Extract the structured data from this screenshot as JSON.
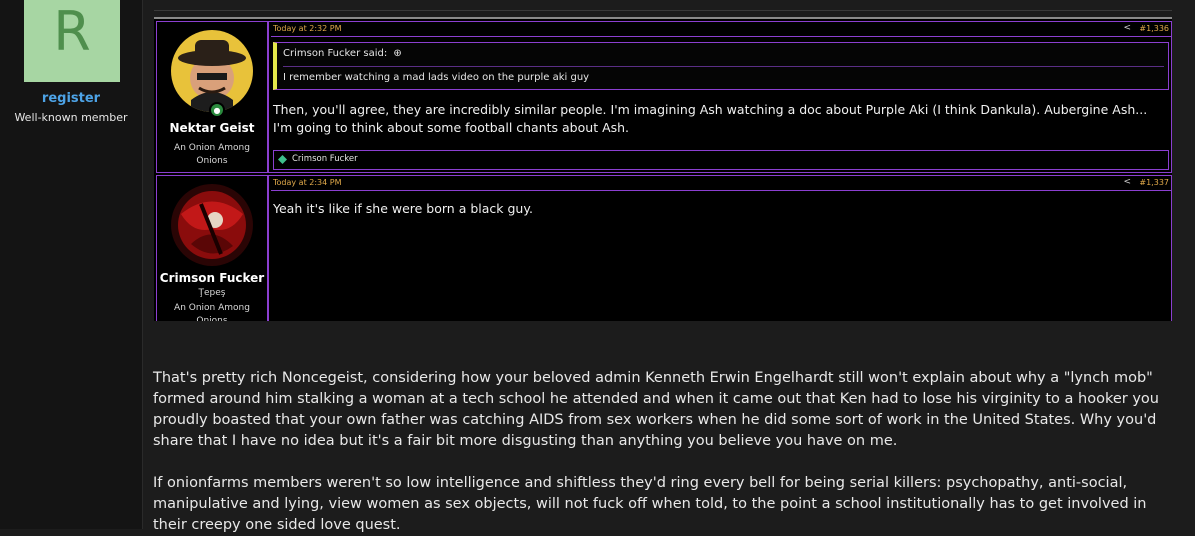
{
  "sidebar": {
    "avatar_letter": "R",
    "username": "register",
    "user_title": "Well-known member"
  },
  "embed": {
    "posts": [
      {
        "username": "Nektar Geist",
        "user_title": "An Onion Among Onions",
        "time": "Today at 2:32 PM",
        "post_number": "#1,336",
        "quote": {
          "author": "Crimson Fucker said:",
          "text": "I remember watching a mad lads video on the purple aki guy"
        },
        "text": "Then, you'll agree, they are incredibly similar people. I'm imagining Ash watching a doc about Purple Aki (I think Dankula). Aubergine Ash... I'm going to think about some football chants about Ash.",
        "reaction_user": "Crimson Fucker"
      },
      {
        "username": "Crimson Fucker",
        "user_subtitle": "Ţepeş",
        "user_title": "An Onion Among Onions",
        "time": "Today at 2:34 PM",
        "post_number": "#1,337",
        "text": "Yeah it's like if she were born a black guy."
      }
    ]
  },
  "post": {
    "paragraph1": "That's pretty rich Noncegeist, considering how your beloved admin Kenneth Erwin Engelhardt still won't explain about why a \"lynch mob\" formed around him stalking a woman at a tech school he attended and when it came out that Ken had to lose his virginity to a hooker you proudly boasted that your own father was catching AIDS from sex workers when he did some sort of work in the United States. Why you'd share that I have no idea but it's a fair bit more disgusting than anything you believe you have on me.",
    "paragraph2": "If onionfarms members weren't so low intelligence and shiftless they'd ring every bell for being serial killers: psychopathy, anti-social, manipulative and lying, view women as sex objects, will not fuck off when told, to the point a school institutionally has to get involved in their creepy one sided love quest."
  }
}
